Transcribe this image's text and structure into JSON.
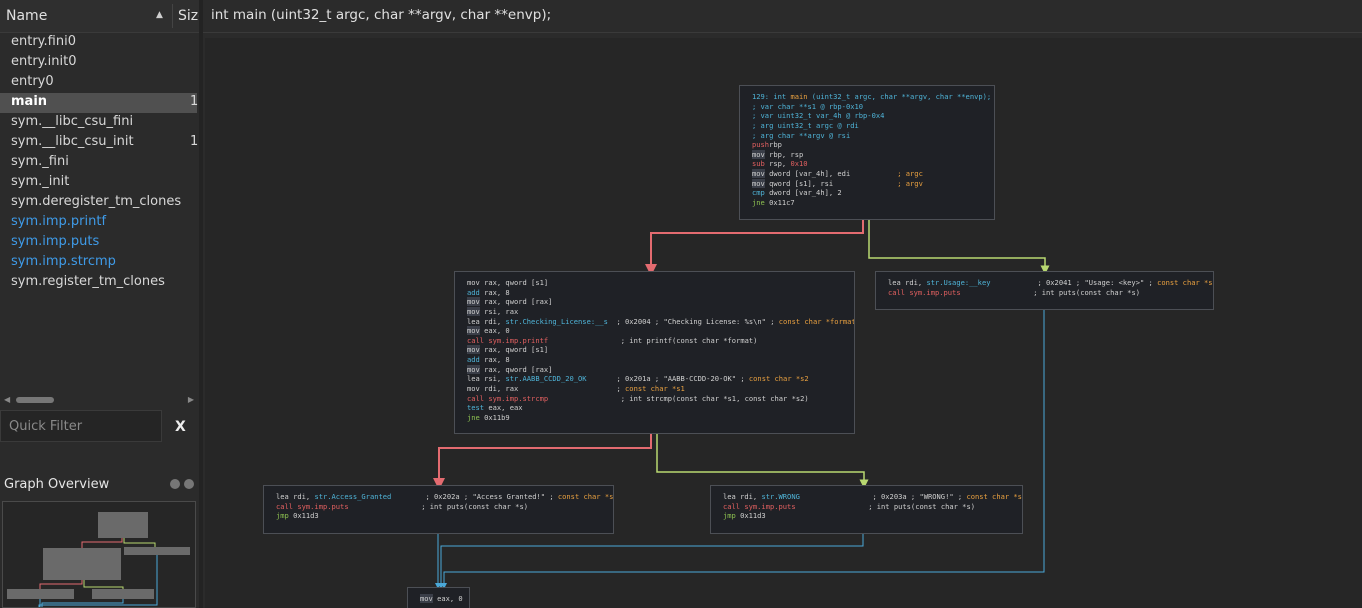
{
  "left_panel": {
    "header": {
      "name": "Name",
      "size": "Size"
    },
    "functions": [
      {
        "label": "entry.fini0",
        "size": "",
        "selected": false,
        "import": false
      },
      {
        "label": "entry.init0",
        "size": "",
        "selected": false,
        "import": false
      },
      {
        "label": "entry0",
        "size": "",
        "selected": false,
        "import": false
      },
      {
        "label": "main",
        "size": "1",
        "selected": true,
        "import": false
      },
      {
        "label": "sym.__libc_csu_fini",
        "size": "",
        "selected": false,
        "import": false
      },
      {
        "label": "sym.__libc_csu_init",
        "size": "1",
        "selected": false,
        "import": false
      },
      {
        "label": "sym._fini",
        "size": "",
        "selected": false,
        "import": false
      },
      {
        "label": "sym._init",
        "size": "",
        "selected": false,
        "import": false
      },
      {
        "label": "sym.deregister_tm_clones",
        "size": "",
        "selected": false,
        "import": false
      },
      {
        "label": "sym.imp.printf",
        "size": "",
        "selected": false,
        "import": true
      },
      {
        "label": "sym.imp.puts",
        "size": "",
        "selected": false,
        "import": true
      },
      {
        "label": "sym.imp.strcmp",
        "size": "",
        "selected": false,
        "import": true
      },
      {
        "label": "sym.register_tm_clones",
        "size": "",
        "selected": false,
        "import": false
      }
    ],
    "quick_filter": {
      "placeholder": "Quick Filter",
      "clear": "X"
    },
    "graph_overview": {
      "title": "Graph Overview"
    }
  },
  "function_signature": "int main (uint32_t argc, char **argv, char **envp);",
  "colors": {
    "edge_false": "#e36b70",
    "edge_true": "#b8d870",
    "edge_jump": "#4aa8d8",
    "import_link": "#3f9be8"
  },
  "blocks": {
    "entry": [
      [
        [
          "c-cyan",
          "129: int "
        ],
        [
          "c-org",
          "main"
        ],
        [
          "c-cyan",
          " (uint32_t argc, char **argv, char **envp);"
        ]
      ],
      [
        [
          "c-cyan",
          "; var char **s1 @ rbp-0x10"
        ]
      ],
      [
        [
          "c-cyan",
          "; var uint32_t var_4h @ rbp-0x4"
        ]
      ],
      [
        [
          "c-cyan",
          "; arg uint32_t argc @ rdi"
        ]
      ],
      [
        [
          "c-cyan",
          "; arg char **argv @ rsi"
        ]
      ],
      [
        [
          "c-red",
          "push"
        ],
        [
          "",
          "rbp"
        ]
      ],
      [
        [
          "c-hl",
          "mov"
        ],
        [
          "",
          " rbp, rsp"
        ]
      ],
      [
        [
          "c-red",
          "sub"
        ],
        [
          "",
          " rsp, "
        ],
        [
          "c-red",
          "0x10"
        ]
      ],
      [
        [
          "c-hl",
          "mov"
        ],
        [
          "",
          " dword [var_4h], edi           "
        ],
        [
          "c-org",
          "; argc"
        ]
      ],
      [
        [
          "c-hl",
          "mov"
        ],
        [
          "",
          " qword [s1], rsi               "
        ],
        [
          "c-org",
          "; argv"
        ]
      ],
      [
        [
          "c-cyan",
          "cmp"
        ],
        [
          "",
          " dword [var_4h], 2"
        ]
      ],
      [
        [
          "c-grn",
          "jne"
        ],
        [
          "",
          " 0x11c7"
        ]
      ]
    ],
    "usage": [
      [
        [
          "",
          "lea rdi, "
        ],
        [
          "c-cyan",
          "str.Usage:__key"
        ],
        [
          "",
          "           ; 0x2041 ; \"Usage: <key>\" ; "
        ],
        [
          "c-org",
          "const char *s"
        ]
      ],
      [
        [
          "c-red",
          "call sym.imp.puts"
        ],
        [
          "",
          "                 ; int puts(const char *s)"
        ]
      ]
    ],
    "check": [
      [
        [
          "",
          "mov rax, qword [s1]"
        ]
      ],
      [
        [
          "c-cyan",
          "add"
        ],
        [
          "",
          " rax, 8"
        ]
      ],
      [
        [
          "c-hl",
          "mov"
        ],
        [
          "",
          " rax, qword [rax]"
        ]
      ],
      [
        [
          "c-hl",
          "mov"
        ],
        [
          "",
          " rsi, rax"
        ]
      ],
      [
        [
          "",
          "lea rdi, "
        ],
        [
          "c-cyan",
          "str.Checking_License:__s"
        ],
        [
          "",
          "  ; 0x2004 ; \"Checking License: %s\\n\" ; "
        ],
        [
          "c-org",
          "const char *format"
        ]
      ],
      [
        [
          "c-hl",
          "mov"
        ],
        [
          "",
          " eax, 0"
        ]
      ],
      [
        [
          "c-red",
          "call sym.imp.printf"
        ],
        [
          "",
          "                 ; int printf(const char *format)"
        ]
      ],
      [
        [
          "c-hl",
          "mov"
        ],
        [
          "",
          " rax, qword [s1]"
        ]
      ],
      [
        [
          "c-cyan",
          "add"
        ],
        [
          "",
          " rax, 8"
        ]
      ],
      [
        [
          "c-hl",
          "mov"
        ],
        [
          "",
          " rax, qword [rax]"
        ]
      ],
      [
        [
          "",
          "lea rsi, "
        ],
        [
          "c-cyan",
          "str.AABB_CCDD_20_OK"
        ],
        [
          "",
          "       ; 0x201a ; \"AABB-CCDD-20-OK\" ; "
        ],
        [
          "c-org",
          "const char *s2"
        ]
      ],
      [
        [
          "",
          "mov rdi, rax                       ; "
        ],
        [
          "c-org",
          "const char *s1"
        ]
      ],
      [
        [
          "c-red",
          "call sym.imp.strcmp"
        ],
        [
          "",
          "                 ; int strcmp(const char *s1, const char *s2)"
        ]
      ],
      [
        [
          "c-cyan",
          "test"
        ],
        [
          "",
          " eax, eax"
        ]
      ],
      [
        [
          "c-grn",
          "jne"
        ],
        [
          "",
          " 0x11b9"
        ]
      ]
    ],
    "granted": [
      [
        [
          "",
          "lea rdi, "
        ],
        [
          "c-cyan",
          "str.Access_Granted"
        ],
        [
          "",
          "        ; 0x202a ; \"Access Granted!\" ; "
        ],
        [
          "c-org",
          "const char *s"
        ]
      ],
      [
        [
          "c-red",
          "call sym.imp.puts"
        ],
        [
          "",
          "                 ; int puts(const char *s)"
        ]
      ],
      [
        [
          "c-grn",
          "jmp"
        ],
        [
          "",
          " 0x11d3"
        ]
      ]
    ],
    "wrong": [
      [
        [
          "",
          "lea rdi, "
        ],
        [
          "c-cyan",
          "str.WRONG"
        ],
        [
          "",
          "                 ; 0x203a ; \"WRONG!\" ; "
        ],
        [
          "c-org",
          "const char *s"
        ]
      ],
      [
        [
          "c-red",
          "call sym.imp.puts"
        ],
        [
          "",
          "                 ; int puts(const char *s)"
        ]
      ],
      [
        [
          "c-grn",
          "jmp"
        ],
        [
          "",
          " 0x11d3"
        ]
      ]
    ],
    "exit": [
      [
        [
          "c-hl",
          "mov"
        ],
        [
          "",
          " eax, 0"
        ]
      ]
    ]
  }
}
